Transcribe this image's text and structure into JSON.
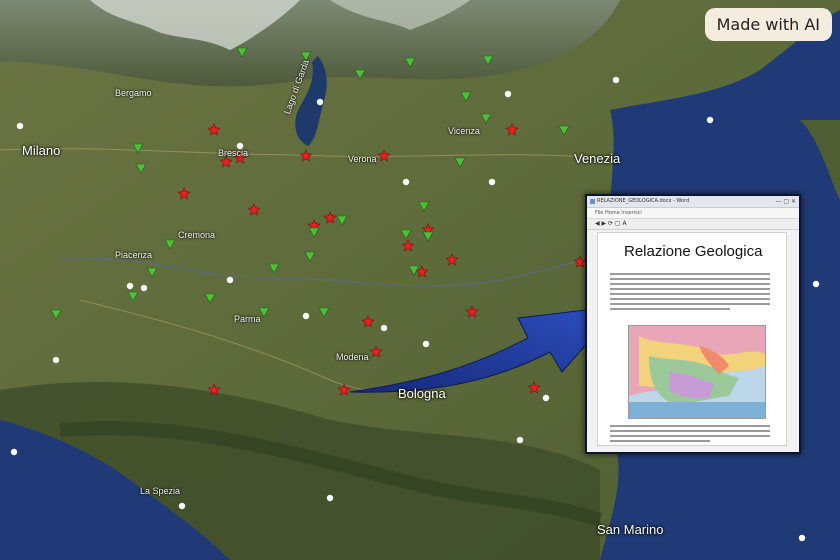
{
  "badge": {
    "text": "Made with AI"
  },
  "cities": {
    "milano": "Milano",
    "venezia": "Venezia",
    "bologna": "Bologna",
    "san_marino": "San Marino",
    "verona": "Verona",
    "vicenza": "Vicenza",
    "bergamo": "Bergamo",
    "brescia": "Brescia",
    "cremona": "Cremona",
    "piacenza": "Piacenza",
    "parma": "Parma",
    "modena": "Modena",
    "lago": "Lago di Garda",
    "la_spezia": "La Spezia"
  },
  "popup": {
    "window_title": "RELAZIONE_GEOLOGICA.docx - Word",
    "window_controls": "— ▢ ✕",
    "toolbar_text": "File  Home  Inserisci",
    "doc_title": "Relazione Geologica"
  },
  "colors": {
    "red_marker": "#e82020",
    "green_marker": "#4fbf3a",
    "white_marker": "#ffffff",
    "arrow": "#1f3a9e",
    "sea": "#1f3a76"
  },
  "markers": {
    "red_count_label": "red star markers",
    "green_count_label": "green triangle markers",
    "white_count_label": "white circle markers"
  }
}
